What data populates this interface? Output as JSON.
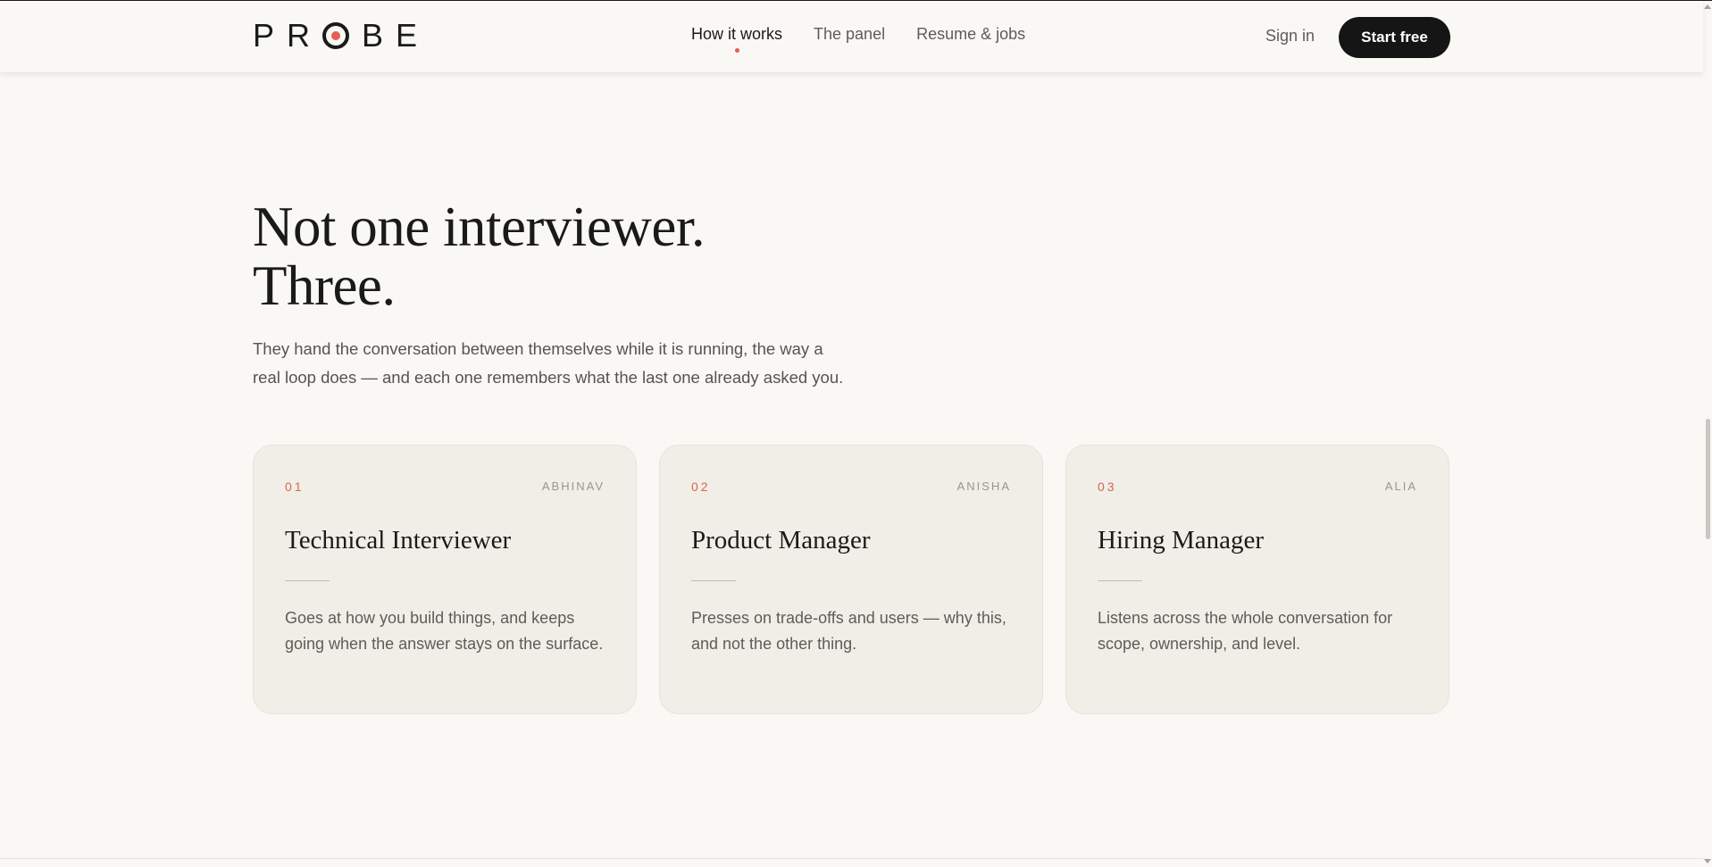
{
  "header": {
    "logo": {
      "before": "PR",
      "after": "BE"
    },
    "nav": [
      {
        "label": "How it works",
        "active": true
      },
      {
        "label": "The panel",
        "active": false
      },
      {
        "label": "Resume & jobs",
        "active": false
      }
    ],
    "signin_label": "Sign in",
    "cta_label": "Start free"
  },
  "hero": {
    "title_line1": "Not one interviewer.",
    "title_line2": "Three.",
    "sub_line1": "They hand the conversation between themselves while it is running, the way a",
    "sub_line2": "real loop does — and each one remembers what the last one already asked you."
  },
  "cards": [
    {
      "num": "01",
      "name": "ABHINAV",
      "title": "Technical Interviewer",
      "desc": "Goes at how you build things, and keeps going when the answer stays on the surface."
    },
    {
      "num": "02",
      "name": "ANISHA",
      "title": "Product Manager",
      "desc": "Presses on trade-offs and users — why this, and not the other thing."
    },
    {
      "num": "03",
      "name": "ALIA",
      "title": "Hiring Manager",
      "desc": "Listens across the whole conversation for scope, ownership, and level."
    }
  ],
  "colors": {
    "accent": "#e2604f",
    "background": "#f9f8f4",
    "card": "#f1eee7",
    "button": "#151515"
  }
}
